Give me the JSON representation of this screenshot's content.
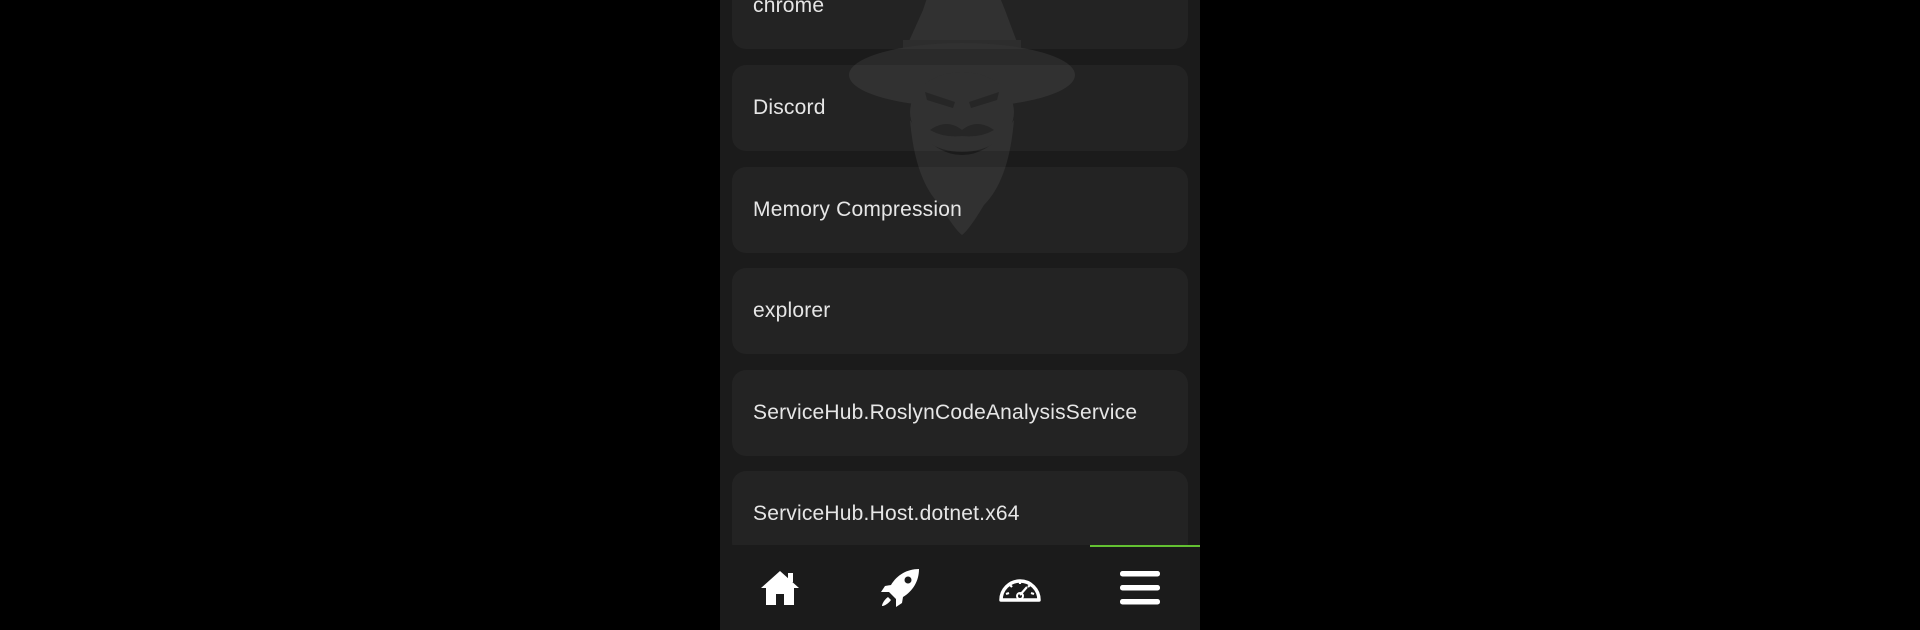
{
  "processes": [
    {
      "name": "chrome"
    },
    {
      "name": "Discord"
    },
    {
      "name": "Memory Compression"
    },
    {
      "name": "explorer"
    },
    {
      "name": "ServiceHub.RoslynCodeAnalysisService"
    },
    {
      "name": "ServiceHub.Host.dotnet.x64"
    }
  ],
  "navbar": {
    "items": [
      {
        "icon": "home-icon"
      },
      {
        "icon": "rocket-icon"
      },
      {
        "icon": "speedometer-icon"
      },
      {
        "icon": "menu-icon"
      }
    ],
    "active_index": 3,
    "accent_color": "#63c132"
  },
  "theme": {
    "background": "#000000",
    "panel": "#1b1b1b",
    "text": "#e6e6e6"
  }
}
